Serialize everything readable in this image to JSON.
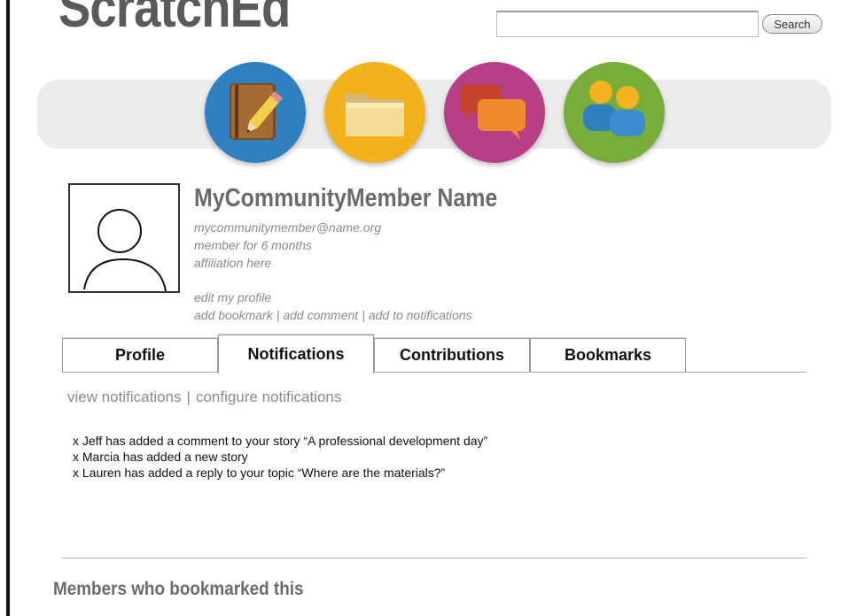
{
  "header": {
    "logo_text": "ScratchEd",
    "search": {
      "value": "",
      "placeholder": "",
      "button_label": "Search"
    }
  },
  "nav": {
    "items": [
      {
        "icon": "notebook-pencil-icon",
        "color": "#2f7fc1"
      },
      {
        "icon": "folder-icon",
        "color": "#f2b21c"
      },
      {
        "icon": "chat-bubbles-icon",
        "color": "#b83f86"
      },
      {
        "icon": "people-icon",
        "color": "#78ad3a"
      }
    ]
  },
  "profile": {
    "name": "MyCommunityMember Name",
    "email": "mycommunitymember@name.org",
    "member_since": "member for 6 months",
    "affiliation": "affiliation here",
    "edit_link": "edit my profile",
    "actions": [
      "add bookmark",
      "add comment",
      "add to notifications"
    ]
  },
  "tabs": [
    {
      "label": "Profile",
      "active": false
    },
    {
      "label": "Notifications",
      "active": true
    },
    {
      "label": "Contributions",
      "active": false
    },
    {
      "label": "Bookmarks",
      "active": false
    }
  ],
  "notifications": {
    "links": [
      "view notifications",
      "configure notifications"
    ],
    "items": [
      "x Jeff has added a comment to your story “A professional development day”",
      "x Marcia has added a new story",
      "x Lauren has added a reply to your topic “Where are the materials?”"
    ]
  },
  "members_section": {
    "heading": "Members who bookmarked this"
  }
}
